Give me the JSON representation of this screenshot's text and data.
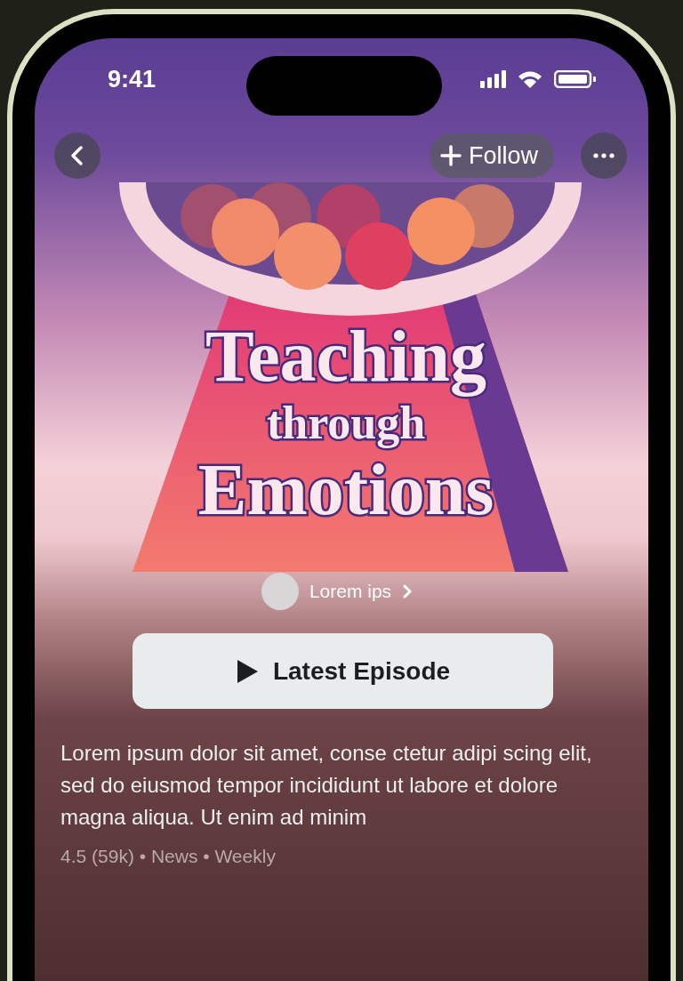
{
  "status_bar": {
    "time": "9:41"
  },
  "nav": {
    "follow_label": "Follow"
  },
  "cover_art": {
    "title_lines": [
      "Teaching",
      "through",
      "Emotions"
    ]
  },
  "author": {
    "name": "Lorem ips"
  },
  "play_button": {
    "label": "Latest Episode"
  },
  "description": "Lorem ipsum dolor sit amet, conse ctetur adipi scing elit, sed do eiusmod tempor incididunt ut labore et dolore magna aliqua. Ut enim ad minim",
  "meta": "4.5 (59k) • News • Weekly"
}
